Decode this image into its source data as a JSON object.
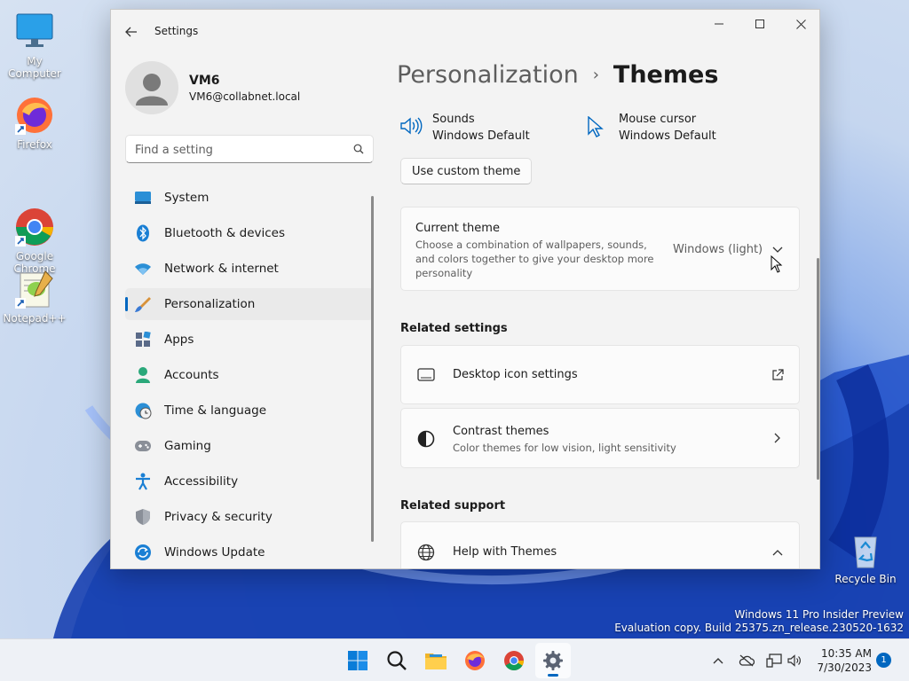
{
  "desktop": {
    "icons": [
      {
        "id": "my-computer",
        "label": "My Computer"
      },
      {
        "id": "firefox",
        "label": "Firefox"
      },
      {
        "id": "google-chrome",
        "label": "Google\nChrome"
      },
      {
        "id": "notepadpp",
        "label": "Notepad++"
      },
      {
        "id": "recycle-bin",
        "label": "Recycle Bin"
      }
    ],
    "watermark": {
      "line1": "Windows 11 Pro Insider Preview",
      "line2": "Evaluation copy. Build 25375.zn_release.230520-1632"
    }
  },
  "window": {
    "app_title": "Settings",
    "user": {
      "name": "VM6",
      "email": "VM6@collabnet.local"
    },
    "search": {
      "placeholder": "Find a setting",
      "value": ""
    },
    "nav": [
      {
        "id": "system",
        "label": "System",
        "icon": "system-icon"
      },
      {
        "id": "bluetooth",
        "label": "Bluetooth & devices",
        "icon": "bluetooth-icon"
      },
      {
        "id": "network",
        "label": "Network & internet",
        "icon": "wifi-icon"
      },
      {
        "id": "personalization",
        "label": "Personalization",
        "icon": "brush-icon",
        "active": true
      },
      {
        "id": "apps",
        "label": "Apps",
        "icon": "apps-icon"
      },
      {
        "id": "accounts",
        "label": "Accounts",
        "icon": "account-icon"
      },
      {
        "id": "time",
        "label": "Time & language",
        "icon": "clock-globe-icon"
      },
      {
        "id": "gaming",
        "label": "Gaming",
        "icon": "gamepad-icon"
      },
      {
        "id": "accessibility",
        "label": "Accessibility",
        "icon": "accessibility-icon"
      },
      {
        "id": "privacy",
        "label": "Privacy & security",
        "icon": "shield-icon"
      },
      {
        "id": "update",
        "label": "Windows Update",
        "icon": "update-icon"
      }
    ],
    "breadcrumb": {
      "parent": "Personalization",
      "separator": "›",
      "current": "Themes"
    },
    "quick_settings": [
      {
        "label": "Sounds",
        "value": "Windows Default",
        "icon": "speaker-icon"
      },
      {
        "label": "Mouse cursor",
        "value": "Windows Default",
        "icon": "mouse-cursor-icon"
      }
    ],
    "custom_theme_button": "Use custom theme",
    "current_theme": {
      "title": "Current theme",
      "description": "Choose a combination of wallpapers, sounds, and colors together to give your desktop more personality",
      "value": "Windows (light)"
    },
    "related_settings": {
      "heading": "Related settings",
      "items": [
        {
          "title": "Desktop icon settings",
          "icon": "monitor-icon",
          "action_icon": "external-link-icon"
        },
        {
          "title": "Contrast themes",
          "desc": "Color themes for low vision, light sensitivity",
          "icon": "contrast-icon",
          "action_icon": "chevron-right-icon"
        }
      ]
    },
    "related_support": {
      "heading": "Related support",
      "items": [
        {
          "title": "Help with Themes",
          "icon": "globe-icon",
          "action_icon": "chevron-up-icon"
        }
      ]
    }
  },
  "taskbar": {
    "apps": [
      "start",
      "search",
      "file-explorer",
      "firefox",
      "chrome",
      "settings"
    ],
    "active_app": "settings",
    "clock": {
      "time": "10:35 AM",
      "date": "7/30/2023"
    },
    "notifications": "1",
    "accent": "#0067c0"
  }
}
